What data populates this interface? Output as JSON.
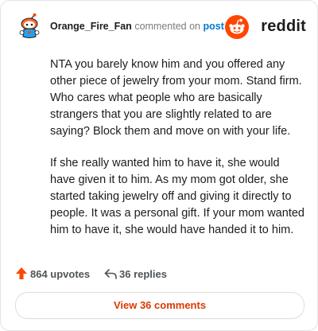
{
  "comment": {
    "username": "Orange_Fire_Fan",
    "action_text": "commented on",
    "post_link_text": "post",
    "paragraphs": [
      "NTA you barely know him and you offered any other piece of jewelry from your mom. Stand firm. Who cares what people who are basically strangers that you are slightly related to are saying? Block them and move on with your life.",
      "If she really wanted him to have it, she would have given it to him. As my mom got older, she started taking jewelry off and giving it directly to people. It was a personal gift. If your mom wanted him to have it, she would have handed it to him."
    ],
    "upvotes": "864 upvotes",
    "replies": "36 replies"
  },
  "brand": {
    "wordmark": "reddit",
    "color": "#ff4500"
  },
  "view_button_label": "View 36 comments",
  "icons": {
    "avatar": "snoo-avatar-icon",
    "logo": "reddit-logo-icon",
    "upvote": "upvote-arrow-icon",
    "reply": "reply-arrow-icon"
  },
  "colors": {
    "accent": "#ff4500",
    "link": "#0079d3",
    "button_text": "#d93a00"
  }
}
